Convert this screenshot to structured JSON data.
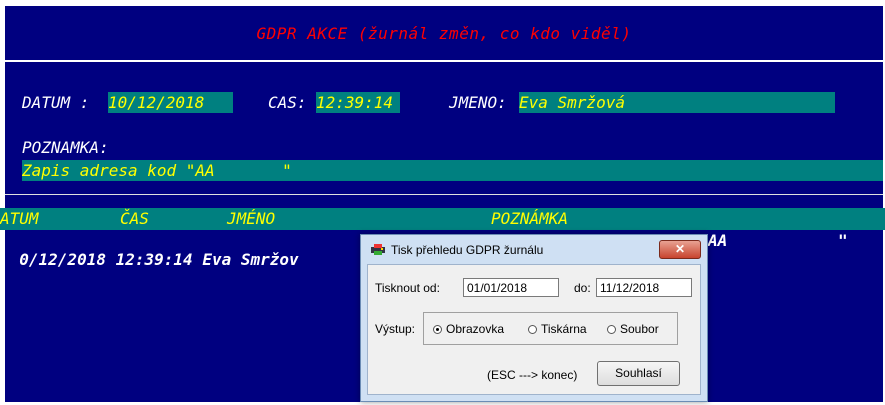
{
  "header": {
    "title": "GDPR AKCE (žurnál změn, co kdo viděl)"
  },
  "form": {
    "datum_label": "DATUM :",
    "datum_value": "10/12/2018",
    "cas_label": "CAS:",
    "cas_value": "12:39:14",
    "jmeno_label": "JMENO:",
    "jmeno_value": "Eva Smržová",
    "poznamka_label": "POZNAMKA:",
    "poznamka_value": "Zapis adresa kod \"AA       \""
  },
  "table": {
    "columns": [
      "ATUM",
      "ČAS",
      "JMÉNO",
      "POZNÁMKA"
    ],
    "row": {
      "date": "0/12/2018",
      "time": "12:39:14",
      "name": "Eva Smržov",
      "note_tail": "AA",
      "quote": "\""
    }
  },
  "dialog": {
    "title": "Tisk přehledu GDPR žurnálu",
    "close_label": "✕",
    "from_label": "Tisknout od:",
    "from_value": "01/01/2018",
    "to_label": "do:",
    "to_value": "11/12/2018",
    "output_label": "Výstup:",
    "options": [
      "Obrazovka",
      "Tiskárna",
      "Soubor"
    ],
    "selected_option": "Obrazovka",
    "esc_hint": "(ESC ---> konec)",
    "ok_label": "Souhlasí"
  },
  "colors": {
    "panel_bg": "#000080",
    "field_bg": "#008080",
    "field_text": "#ffff00",
    "title_text": "#ff0000"
  }
}
